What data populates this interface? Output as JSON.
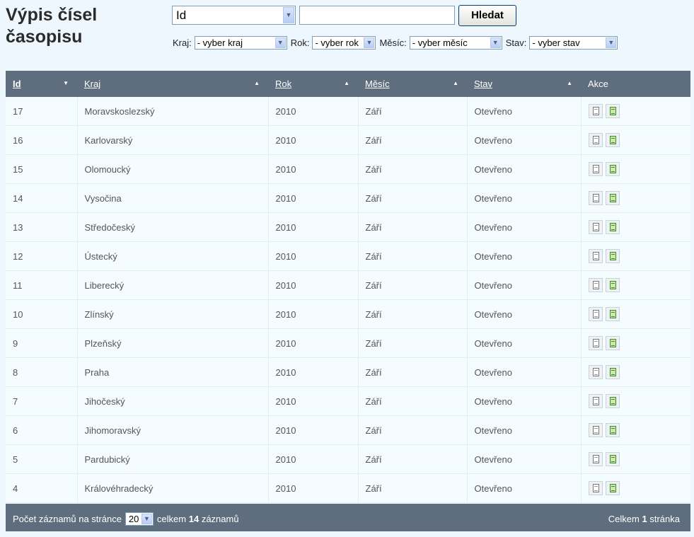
{
  "page": {
    "title_line1": "Výpis čísel",
    "title_line2": "časopisu"
  },
  "search": {
    "field_selected": "Id",
    "query": "",
    "button_label": "Hledat"
  },
  "filters": {
    "kraj_label": "Kraj:",
    "kraj_value": "- vyber kraj",
    "rok_label": "Rok:",
    "rok_value": "- vyber rok",
    "mesic_label": "Měsíc:",
    "mesic_value": "- vyber měsíc",
    "stav_label": "Stav:",
    "stav_value": "- vyber stav"
  },
  "table": {
    "headers": {
      "id": "Id",
      "kraj": "Kraj",
      "rok": "Rok",
      "mesic": "Měsíc",
      "stav": "Stav",
      "akce": "Akce"
    },
    "rows": [
      {
        "id": "17",
        "kraj": "Moravskoslezský",
        "rok": "2010",
        "mesic": "Září",
        "stav": "Otevřeno"
      },
      {
        "id": "16",
        "kraj": "Karlovarský",
        "rok": "2010",
        "mesic": "Září",
        "stav": "Otevřeno"
      },
      {
        "id": "15",
        "kraj": "Olomoucký",
        "rok": "2010",
        "mesic": "Září",
        "stav": "Otevřeno"
      },
      {
        "id": "14",
        "kraj": "Vysočina",
        "rok": "2010",
        "mesic": "Září",
        "stav": "Otevřeno"
      },
      {
        "id": "13",
        "kraj": "Středočeský",
        "rok": "2010",
        "mesic": "Září",
        "stav": "Otevřeno"
      },
      {
        "id": "12",
        "kraj": "Ústecký",
        "rok": "2010",
        "mesic": "Září",
        "stav": "Otevřeno"
      },
      {
        "id": "11",
        "kraj": "Liberecký",
        "rok": "2010",
        "mesic": "Září",
        "stav": "Otevřeno"
      },
      {
        "id": "10",
        "kraj": "Zlínský",
        "rok": "2010",
        "mesic": "Září",
        "stav": "Otevřeno"
      },
      {
        "id": "9",
        "kraj": "Plzeňský",
        "rok": "2010",
        "mesic": "Září",
        "stav": "Otevřeno"
      },
      {
        "id": "8",
        "kraj": "Praha",
        "rok": "2010",
        "mesic": "Září",
        "stav": "Otevřeno"
      },
      {
        "id": "7",
        "kraj": "Jihočeský",
        "rok": "2010",
        "mesic": "Září",
        "stav": "Otevřeno"
      },
      {
        "id": "6",
        "kraj": "Jihomoravský",
        "rok": "2010",
        "mesic": "Září",
        "stav": "Otevřeno"
      },
      {
        "id": "5",
        "kraj": "Pardubický",
        "rok": "2010",
        "mesic": "Září",
        "stav": "Otevřeno"
      },
      {
        "id": "4",
        "kraj": "Královéhradecký",
        "rok": "2010",
        "mesic": "Září",
        "stav": "Otevřeno"
      }
    ]
  },
  "footer": {
    "per_page_label": "Počet záznamů na stránce",
    "per_page_value": "20",
    "total_prefix": "celkem",
    "total_count": "14",
    "total_suffix": "záznamů",
    "pages_prefix": "Celkem",
    "pages_count": "1",
    "pages_suffix": "stránka"
  }
}
